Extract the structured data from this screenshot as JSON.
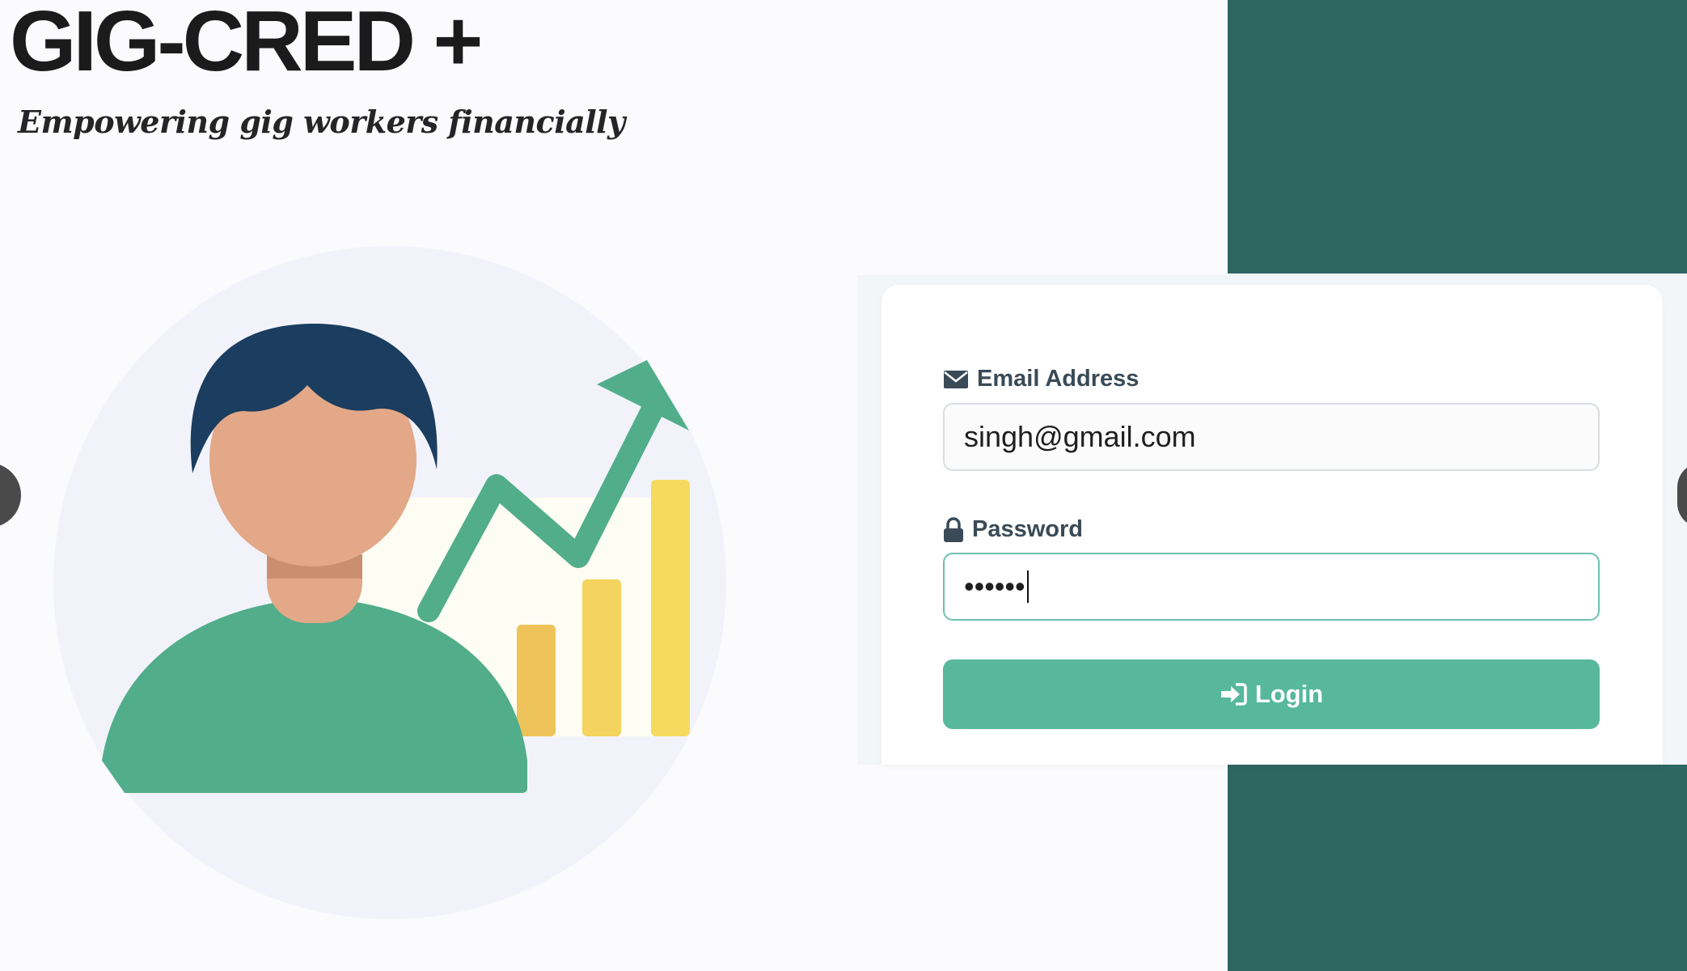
{
  "brand": {
    "title": "GIG-CRED +",
    "tagline": "Empowering gig  workers financially"
  },
  "form": {
    "email": {
      "label": "Email Address",
      "value": "singh@gmail.com",
      "icon": "envelope-icon"
    },
    "password": {
      "label": "Password",
      "value": "••••••",
      "icon": "lock-icon"
    },
    "login_button": {
      "label": "Login",
      "icon": "sign-in-icon"
    }
  },
  "colors": {
    "accent": "#57b89c",
    "panel": "#2e6662",
    "focus_border": "#6fc0ad"
  }
}
